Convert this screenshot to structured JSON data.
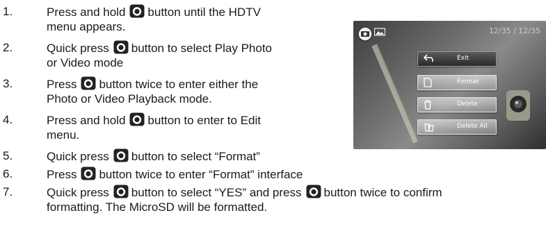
{
  "steps": [
    {
      "number": "1.",
      "before": "Press and hold",
      "after": "button until the HDTV",
      "continuation": "menu appears."
    },
    {
      "number": "2.",
      "before": "Quick press",
      "after": "button to select Play Photo",
      "continuation": "or Video mode"
    },
    {
      "number": "3.",
      "before": "Press",
      "after": "button twice to enter either the",
      "continuation": "Photo or Video Playback mode."
    },
    {
      "number": "4.",
      "before": "Press and hold",
      "after": "button to enter to Edit",
      "continuation": "menu."
    },
    {
      "number": "5.",
      "before": "Quick press",
      "after": "button to select “Format”"
    },
    {
      "number": "6.",
      "before": "Press",
      "after": "button twice to enter “Format” interface"
    },
    {
      "number": "7.",
      "before": "Quick press",
      "middle": "button to select “YES” and press",
      "after": "button twice to confirm",
      "continuation": "formatting. The MicroSD will be formatted."
    }
  ],
  "screen": {
    "counter": "12/35 / 12/35",
    "menu": [
      "Exit",
      "Format",
      "Delete",
      "Delete All"
    ],
    "selected_menu": "Exit"
  },
  "icons": {
    "button": "camera-button-icon",
    "exit": "back-arrow-icon",
    "format": "sd-card-icon",
    "delete": "trash-icon",
    "delete_all": "trash-multiple-icon"
  }
}
